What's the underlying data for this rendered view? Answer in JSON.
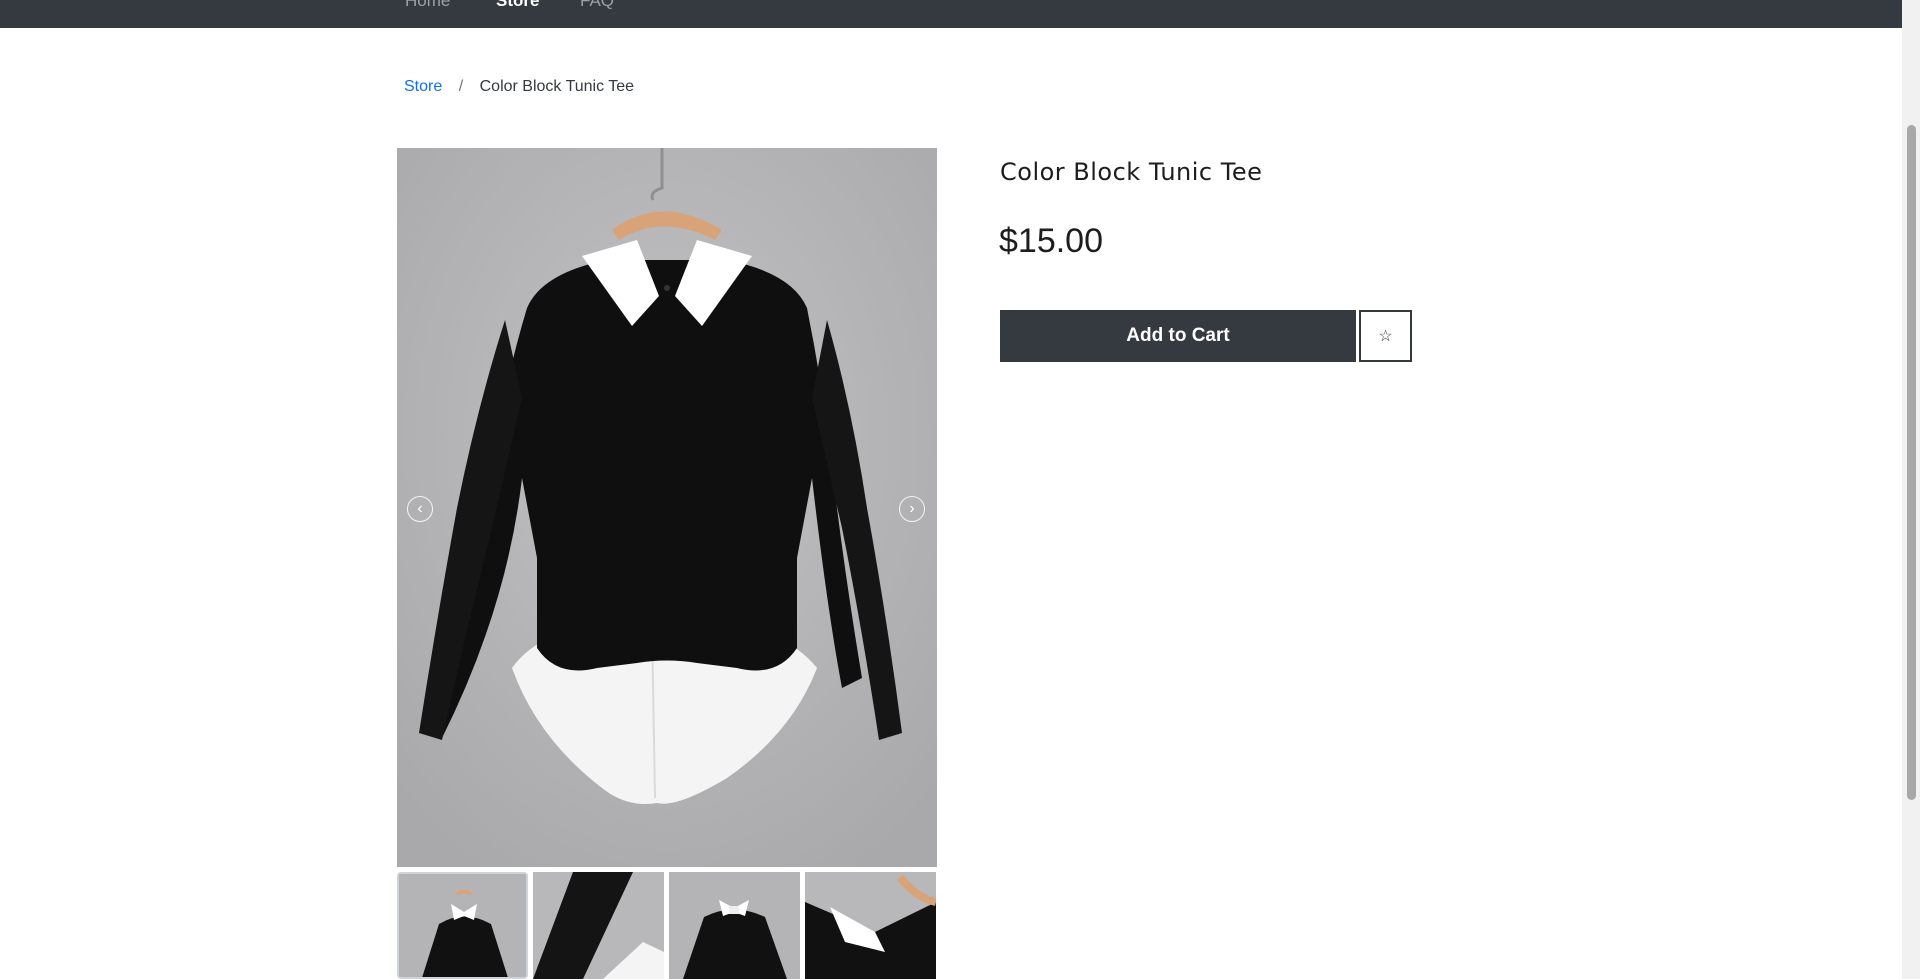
{
  "nav": {
    "items": [
      {
        "label": "Home"
      },
      {
        "label": "Store"
      },
      {
        "label": "FAQ"
      }
    ],
    "active": "Store"
  },
  "breadcrumb": {
    "store_label": "Store",
    "separator": "/",
    "current": "Color Block Tunic Tee"
  },
  "product": {
    "title": "Color Block Tunic Tee",
    "price": "$15.00",
    "add_to_cart_label": "Add to Cart",
    "wishlist_icon": "star-outline-icon"
  },
  "gallery": {
    "thumbnail_count": 4,
    "selected_thumbnail": 1,
    "prev_icon": "chevron-left-icon",
    "next_icon": "chevron-right-icon"
  },
  "colors": {
    "nav_bg": "#343a40",
    "link": "#0d6efd",
    "button_bg": "#343a40",
    "image_bg": "#b4b4b6"
  }
}
